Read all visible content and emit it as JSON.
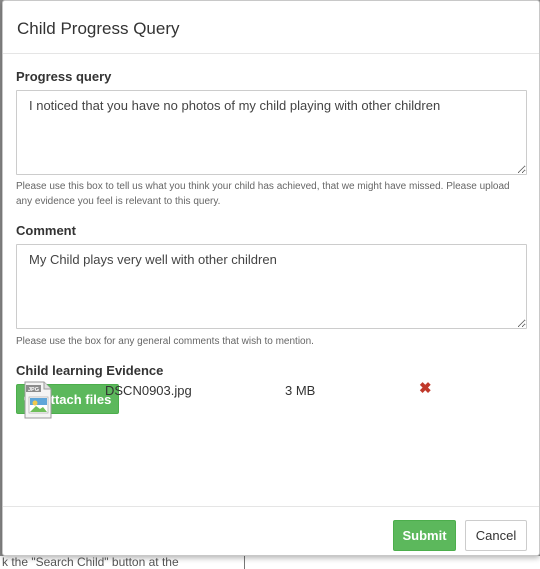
{
  "dialog": {
    "title": "Child Progress Query"
  },
  "progress_query": {
    "label": "Progress query",
    "value": "I noticed that you have no photos of my child playing with other children",
    "help": "Please use this box to tell us what you think your child has achieved, that we might have missed. Please upload any evidence you feel is relevant to this query."
  },
  "comment": {
    "label": "Comment",
    "value": "My Child plays very well with other children",
    "help": "Please use the box for any general comments that wish to mention."
  },
  "evidence": {
    "label": "Child learning Evidence",
    "attach_label": "Attach files",
    "files": [
      {
        "name": "DSCN0903.jpg",
        "size": "3 MB",
        "icon": "jpg-file-icon",
        "icon_text": "JPG"
      }
    ]
  },
  "footer": {
    "submit_label": "Submit",
    "cancel_label": "Cancel"
  },
  "backdrop": {
    "text": "k the \"Search Child\" button at the"
  },
  "colors": {
    "success": "#5cb85c",
    "danger": "#c0392b",
    "border": "#cccccc"
  }
}
